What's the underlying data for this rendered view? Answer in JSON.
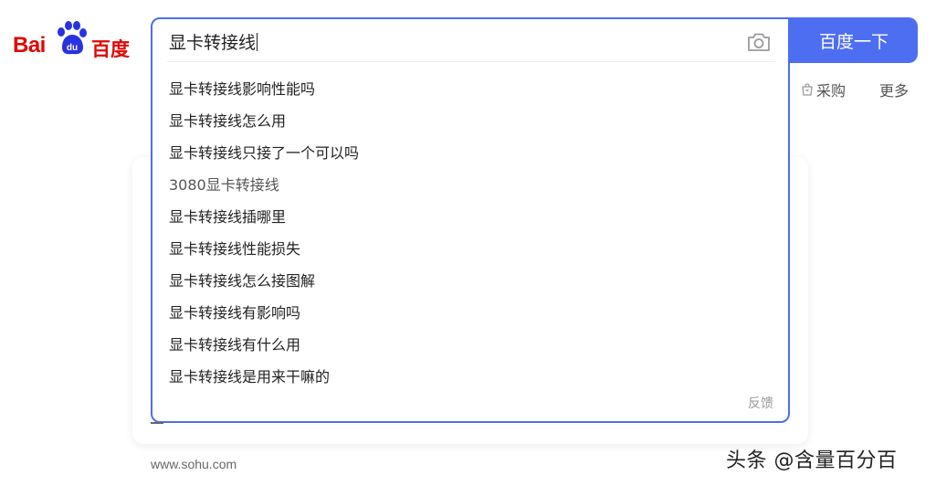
{
  "logo": {
    "left_text": "Bai",
    "right_text": "百度",
    "paw_text": "du"
  },
  "search": {
    "value": "显卡转接线",
    "button_label": "百度一下",
    "camera_icon": "camera-icon"
  },
  "suggestions": [
    {
      "query": "显卡转接线",
      "rest": "影响性能吗"
    },
    {
      "query": "显卡转接线",
      "rest": "怎么用"
    },
    {
      "query": "显卡转接线",
      "rest": "只接了一个可以吗"
    },
    {
      "query": "",
      "rest": "3080显卡转接线"
    },
    {
      "query": "显卡转接线",
      "rest": "插哪里"
    },
    {
      "query": "显卡转接线",
      "rest": "性能损失"
    },
    {
      "query": "显卡转接线",
      "rest": "怎么接图解"
    },
    {
      "query": "显卡转接线",
      "rest": "有影响吗"
    },
    {
      "query": "显卡转接线",
      "rest": "有什么用"
    },
    {
      "query": "显卡转接线",
      "rest": "是用来干嘛的"
    }
  ],
  "feedback_label": "反馈",
  "tabs": {
    "purchase": "采购",
    "more": "更多"
  },
  "footer": {
    "url": "www.sohu.com"
  },
  "watermark": "头条 @含量百分百",
  "colors": {
    "accent": "#4e6ef2",
    "brand_red": "#e10602"
  }
}
